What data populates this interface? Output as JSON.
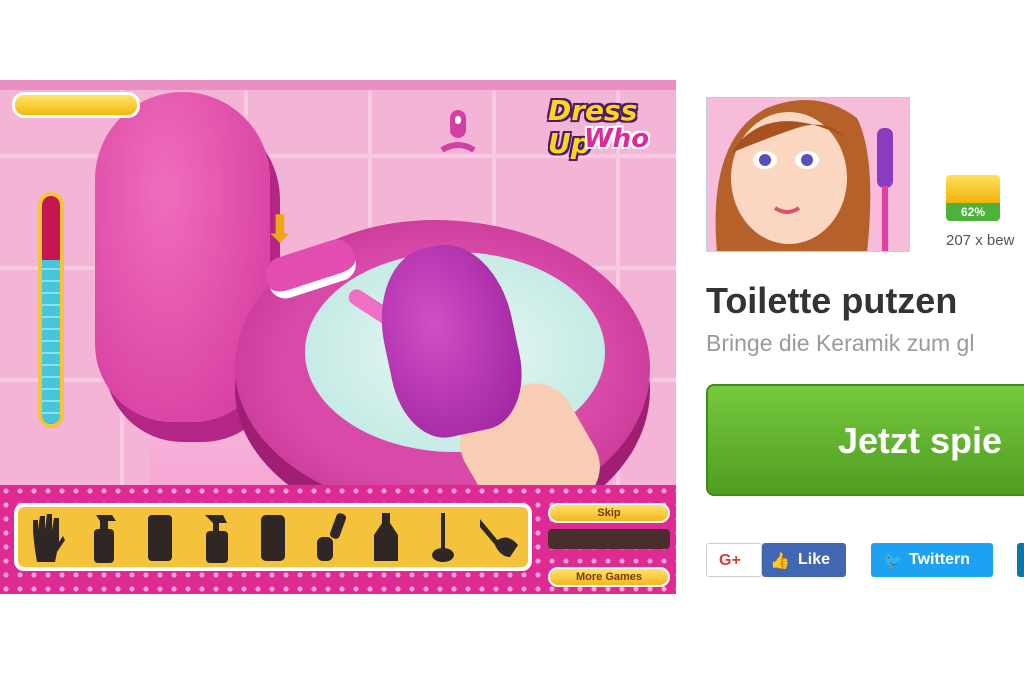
{
  "game": {
    "logo_line1": "Dress Up",
    "logo_line2": "Who",
    "skip_label": "Skip",
    "more_games_label": "More Games",
    "meter_level": 0.72,
    "tools": [
      "glove-icon",
      "spray-bottle-icon",
      "sponge-icon",
      "spray-cleaner-icon",
      "cloth-icon",
      "scrub-brush-icon",
      "detergent-bottle-icon",
      "toilet-brush-icon",
      "plunger-icon"
    ]
  },
  "info": {
    "rating_percent": "62%",
    "votes_text": "207  x bew",
    "title": "Toilette putzen",
    "subtitle": "Bringe die Keramik zum gl",
    "play_label": "Jetzt spie"
  },
  "social": {
    "gplus_label": "G+",
    "facebook_label": "Like",
    "twitter_label": "Twittern"
  },
  "colors": {
    "game_pink": "#df2a94",
    "play_green": "#5aac2a",
    "facebook_blue": "#4267b2",
    "twitter_blue": "#1da1f2"
  }
}
